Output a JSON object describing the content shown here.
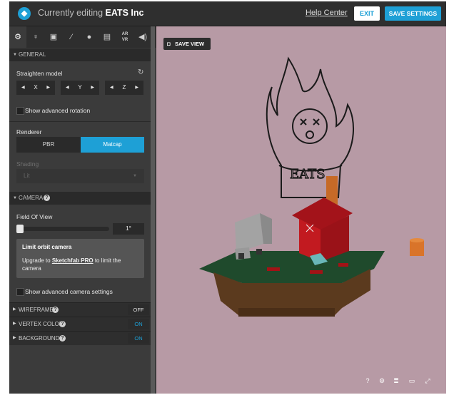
{
  "header": {
    "editing_label": "Currently editing",
    "project_name": "EATS Inc",
    "help_label": "Help Center",
    "exit_label": "EXIT",
    "save_label": "SAVE SETTINGS"
  },
  "tabs": [
    "gear-icon",
    "bulb-icon",
    "image-icon",
    "wand-icon",
    "pin-icon",
    "film-icon",
    "AR VR",
    "sound-icon"
  ],
  "tab_vr_label": "AR\nVR",
  "general": {
    "header": "GENERAL",
    "straighten_label": "Straighten model",
    "axes": [
      "X",
      "Y",
      "Z"
    ],
    "adv_rotation_label": "Show advanced rotation",
    "renderer_label": "Renderer",
    "renderer_options": [
      "PBR",
      "Matcap"
    ],
    "renderer_selected": "Matcap",
    "shading_label": "Shading",
    "shading_value": "Lit"
  },
  "camera": {
    "header": "CAMERA",
    "fov_label": "Field Of View",
    "fov_value": "1°",
    "limit_title": "Limit orbit camera",
    "limit_prefix": "Upgrade to ",
    "limit_link": "Sketchfab PRO",
    "limit_suffix": " to limit the camera",
    "adv_camera_label": "Show advanced camera settings"
  },
  "rows": [
    {
      "label": "WIREFRAME",
      "state": "OFF"
    },
    {
      "label": "VERTEX COLOR",
      "state": "ON"
    },
    {
      "label": "BACKGROUND",
      "state": "ON"
    }
  ],
  "viewport": {
    "save_view_label": "SAVE VIEW",
    "sign_text": "EATS",
    "background": "#b79aa5"
  },
  "colors": {
    "accent": "#1ea0d6"
  }
}
